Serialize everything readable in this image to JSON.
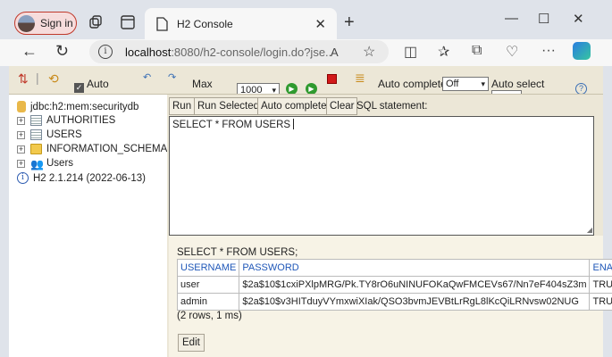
{
  "browser": {
    "signin_label": "Sign in",
    "tab_title": "H2 Console",
    "url_domain": "localhost",
    "url_rest": ":8080/h2-console/login.do?jse...",
    "readaloud": "Aᵭ"
  },
  "toolbar": {
    "auto_commit_label": "Auto",
    "max_label": "Max",
    "max_rows_value": "1000",
    "auto_complete_label": "Auto complete",
    "auto_complete_value": "Off",
    "auto_select_label": "Auto select",
    "help": "?"
  },
  "tree": {
    "connection": "jdbc:h2:mem:securitydb",
    "items": [
      "AUTHORITIES",
      "USERS",
      "INFORMATION_SCHEMA",
      "Users"
    ],
    "version": "H2 2.1.214 (2022-06-13)"
  },
  "query": {
    "run_label": "Run",
    "run_selected_label": "Run Selected",
    "auto_complete_label": "Auto complete",
    "clear_label": "Clear",
    "sql_statement_label": "SQL statement:",
    "sql_text": "SELECT * FROM USERS"
  },
  "results": {
    "query_echo": "SELECT * FROM USERS;",
    "columns": [
      "USERNAME",
      "PASSWORD",
      "ENABI"
    ],
    "rows": [
      [
        "user",
        "$2a$10$1cxiPXlpMRG/Pk.TY8rO6uNINUFOKaQwFMCEVs67/Nn7eF404sZ3m",
        "TRUE"
      ],
      [
        "admin",
        "$2a$10$v3HITduyVYmxwiXIak/QSO3bvmJEVBtLrRgL8lKcQiLRNvsw02NUG",
        "TRUE"
      ]
    ],
    "row_count": "(2 rows, 1 ms)",
    "edit_label": "Edit"
  },
  "colors": {
    "panel_bg": "#ece7d7",
    "header_link": "#1f57b8",
    "browser_chrome": "#dfe3ea"
  }
}
